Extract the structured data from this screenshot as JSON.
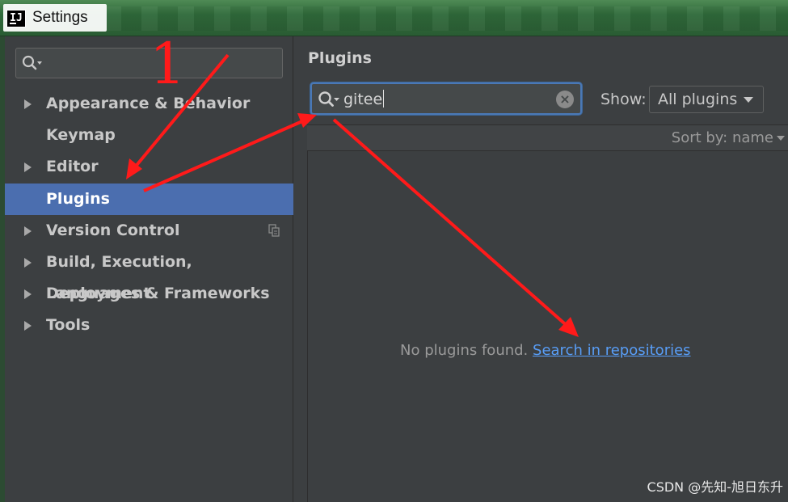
{
  "window": {
    "title": "Settings",
    "app_icon_text": "IJ"
  },
  "sidebar": {
    "search_value": "",
    "items": [
      {
        "label": "Appearance & Behavior",
        "expandable": true,
        "selected": false
      },
      {
        "label": "Keymap",
        "expandable": false,
        "selected": false
      },
      {
        "label": "Editor",
        "expandable": true,
        "selected": false
      },
      {
        "label": "Plugins",
        "expandable": false,
        "selected": true
      },
      {
        "label": "Version Control",
        "expandable": true,
        "selected": false,
        "trailing_icon": "copy-icon"
      },
      {
        "label": "Build, Execution, Deployment",
        "expandable": true,
        "selected": false
      },
      {
        "label": "Languages & Frameworks",
        "expandable": true,
        "selected": false
      },
      {
        "label": "Tools",
        "expandable": true,
        "selected": false
      }
    ]
  },
  "main": {
    "section_title": "Plugins",
    "search_value": "gitee",
    "show_label": "Show:",
    "show_selected": "All plugins",
    "sort_label": "Sort by: name",
    "empty_text": "No plugins found.",
    "empty_link": "Search in repositories"
  },
  "annotation": {
    "number_label": "1",
    "arrow_color": "#ff1a1a"
  },
  "watermark": "CSDN @先知-旭日东升",
  "colors": {
    "selection": "#4b6eaf",
    "link": "#589df6",
    "focus_border": "#4a78b5",
    "panel_bg": "#3c3f41"
  }
}
